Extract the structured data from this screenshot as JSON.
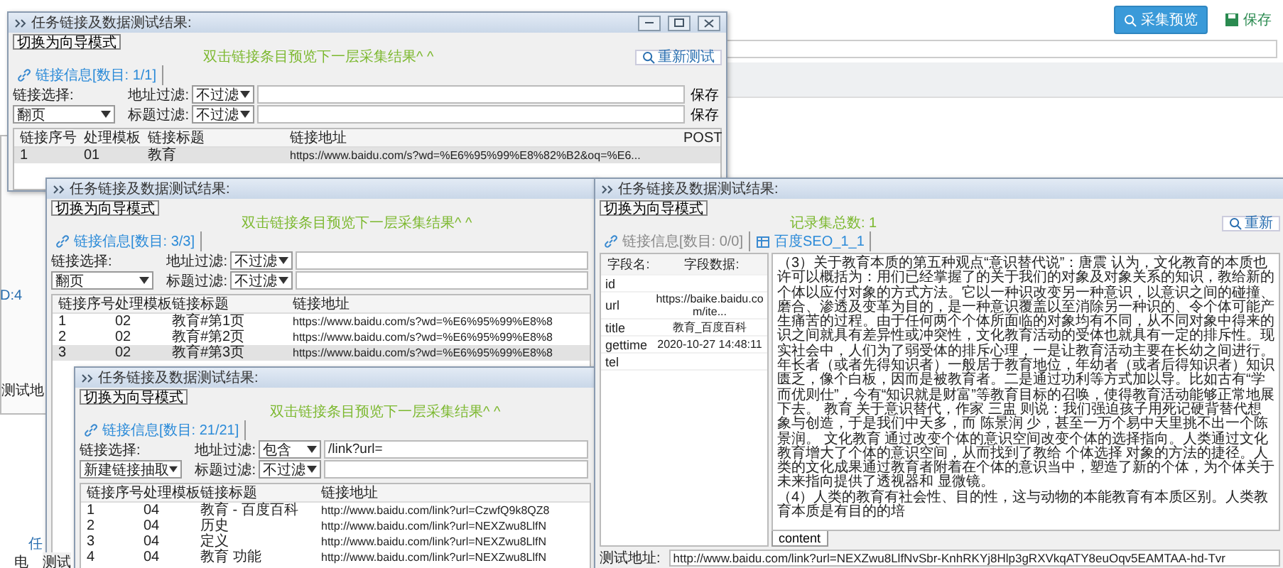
{
  "app_toolbar": {
    "buttons": [
      {
        "label": "采集预览",
        "kind": "preview"
      },
      {
        "label": "保存",
        "kind": "save"
      }
    ]
  },
  "fragments": [
    "D:4",
    "测试地",
    "任",
    "电",
    "测试"
  ],
  "windows": [
    {
      "title": "任务链接及数据测试结果:",
      "controls": true,
      "mode_button": "切换为向导模式",
      "hint": "双击链接条目预览下一层采集结果^ ^",
      "retest_button": "重新测试",
      "tabs": [
        {
          "label": "链接信息[数目: 1/1]",
          "kind": "link",
          "selected": true
        }
      ],
      "filters": {
        "link_select_label": "链接选择:",
        "link_select": "翻页",
        "address_label": "地址过滤:",
        "address_mode": "不过滤",
        "title_label": "标题过滤:",
        "title_mode": "不过滤",
        "save_buttons": [
          "保存",
          "保存"
        ]
      },
      "table": {
        "columns": [
          "链接序号",
          "处理模板",
          "链接标题",
          "链接地址",
          "POST"
        ],
        "rows": [
          {
            "cells": [
              "1",
              "01",
              "教育",
              "https://www.baidu.com/s?wd=%E6%95%99%E8%82%B2&oq=%E6..."
            ],
            "selected": true
          }
        ]
      }
    },
    {
      "title": "任务链接及数据测试结果:",
      "controls": false,
      "mode_button": "切换为向导模式",
      "hint": "双击链接条目预览下一层采集结果^ ^",
      "tabs": [
        {
          "label": "链接信息[数目: 3/3]",
          "kind": "link",
          "selected": true
        }
      ],
      "filters": {
        "link_select_label": "链接选择:",
        "link_select": "翻页",
        "address_label": "地址过滤:",
        "address_mode": "不过滤",
        "title_label": "标题过滤:",
        "title_mode": "不过滤"
      },
      "table": {
        "columns": [
          "链接序号",
          "处理模板",
          "链接标题",
          "链接地址"
        ],
        "rows": [
          {
            "cells": [
              "1",
              "02",
              "教育#第1页",
              "https://www.baidu.com/s?wd=%E6%95%99%E8%8"
            ],
            "selected": false
          },
          {
            "cells": [
              "2",
              "02",
              "教育#第2页",
              "https://www.baidu.com/s?wd=%E6%95%99%E8%8"
            ],
            "selected": false
          },
          {
            "cells": [
              "3",
              "02",
              "教育#第3页",
              "https://www.baidu.com/s?wd=%E6%95%99%E8%8"
            ],
            "selected": true
          }
        ]
      }
    },
    {
      "title": "任务链接及数据测试结果:",
      "controls": false,
      "mode_button": "切换为向导模式",
      "hint": "双击链接条目预览下一层采集结果^ ^",
      "tabs": [
        {
          "label": "链接信息[数目: 21/21]",
          "kind": "link",
          "selected": true
        }
      ],
      "filters": {
        "link_select_label": "链接选择:",
        "link_select": "新建链接抽取",
        "address_label": "地址过滤:",
        "address_mode": "包含",
        "address_value": "/link?url=",
        "title_label": "标题过滤:",
        "title_mode": "不过滤"
      },
      "table": {
        "columns": [
          "链接序号",
          "处理模板",
          "链接标题",
          "链接地址"
        ],
        "rows": [
          {
            "cells": [
              "1",
              "04",
              "教育 - 百度百科",
              "http://www.baidu.com/link?url=CzwfQ9k8QZ8"
            ],
            "selected": false
          },
          {
            "cells": [
              "2",
              "04",
              "历史",
              "http://www.baidu.com/link?url=NEXZwu8LlfN"
            ],
            "selected": false
          },
          {
            "cells": [
              "3",
              "04",
              "定义",
              "http://www.baidu.com/link?url=NEXZwu8LlfN"
            ],
            "selected": false
          },
          {
            "cells": [
              "4",
              "04",
              "教育 功能",
              "http://www.baidu.com/link?url=NEXZwu8LlfN"
            ],
            "selected": false
          }
        ]
      }
    },
    {
      "title": "任务链接及数据测试结果:",
      "controls": false,
      "mode_button": "切换为向导模式",
      "hint": "记录集总数: 1",
      "retest_button": "重新",
      "tabs": [
        {
          "label": "链接信息[数目: 0/0]",
          "kind": "link",
          "selected": false
        },
        {
          "label": "百度SEO_1_1",
          "kind": "table",
          "selected": true
        }
      ],
      "fields": {
        "columns": [
          "字段名:",
          "字段数据:"
        ],
        "rows": [
          {
            "name": "id"
          },
          {
            "name": "url",
            "value": "https://baike.baidu.com/ite..."
          },
          {
            "name": "title",
            "value": "教育_百度百科"
          },
          {
            "name": "gettime",
            "value": "2020-10-27 14:48:11"
          },
          {
            "name": "tel"
          }
        ]
      },
      "content": {
        "paragraphs": [
          "（3）关于教育本质的第五种观点“意识替代说”：唐震 认为，文化教育的本质也许可以概括为：用们已经掌握了的关于我们的对象及对象关系的知识，教给新的个体以应付对象的方式方法。它以一种识改变另一种意识，以意识之间的碰撞、磨合、渗透及变革为目的，是一种意识覆盖以至消除另一种识的、令个体可能产生痛苦的过程。由于任何两个个体所面临的对象均有不同，从不同对象中得来的识之间就具有差异性或冲突性，文化教育活动的受体也就具有一定的排斥性。现实社会中，人们为了弱受体的排斥心理，一是让教育活动主要在长幼之间进行。年长者（或者先得知识者）一般居于教育地位，年幼者（或者后得知识者）知识匮乏，像个白板，因而是被教育者。二是通过功利等方式加以导。比如古有“学而优则仕”，今有“知识就是财富”等教育目标的召唤，使得教育活动能够正常地展下去。 教育 关于意识替代，作家 三盅 则说：我们强迫孩子用死记硬背替代想象与创造，于是我们中天多，而 陈景润 少，甚至一万个易中天里挑不出一个陈景润。 文化教育 通过改变个体的意识空间改变个体的选择指向。人类通过文化教育增大了个体的意识空间，从而找到了教给 个体选择 对象的方法的捷径。人类的文化成果通过教育者附着在个体的意识当中，塑造了新的个体，为个体关于未来指向提供了透视器和 显微镜。",
          "（4）人类的教育有社会性、目的性，这与动物的本能教育有本质区别。人类教育本质是有目的的培"
        ],
        "tab": "content"
      },
      "test_address": {
        "label": "测试地址:",
        "value": "http://www.baidu.com/link?url=NEXZwu8LlfNvSbr-KnhRKYj8Hlp3gRXVkqATY8euOqv5EAMTAA-hd-Tvr"
      }
    }
  ]
}
